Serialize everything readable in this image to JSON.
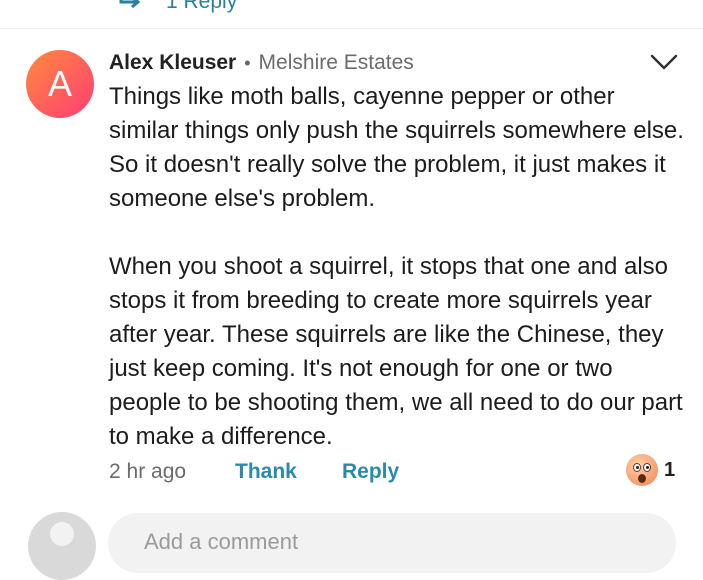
{
  "prev_reply": {
    "icon": "reply-arrow-icon",
    "label": "1 Reply"
  },
  "comment": {
    "avatar_letter": "A",
    "author": "Alex Kleuser",
    "separator": "•",
    "neighborhood": "Melshire Estates",
    "paragraphs": [
      "Things like moth balls, cayenne pepper or other similar things only push the squirrels somewhere else. So it doesn't really solve the problem, it just makes it someone else's problem.",
      "When you shoot a squirrel, it stops that one and also stops it from breeding to create more squirrels year after year. These squirrels are like the Chinese, they just keep coming. It's not enough for one or two people to be shooting them, we all need to do our part to make a difference."
    ],
    "time": "2 hr ago",
    "thank_label": "Thank",
    "reply_label": "Reply",
    "reaction": {
      "icon": "wow-emoji-icon",
      "count": "1"
    }
  },
  "composer": {
    "placeholder": "Add a comment"
  },
  "colors": {
    "accent": "#2a8aad",
    "avatar_gradient_start": "#ff8a3d",
    "avatar_gradient_end": "#ff3d74"
  }
}
